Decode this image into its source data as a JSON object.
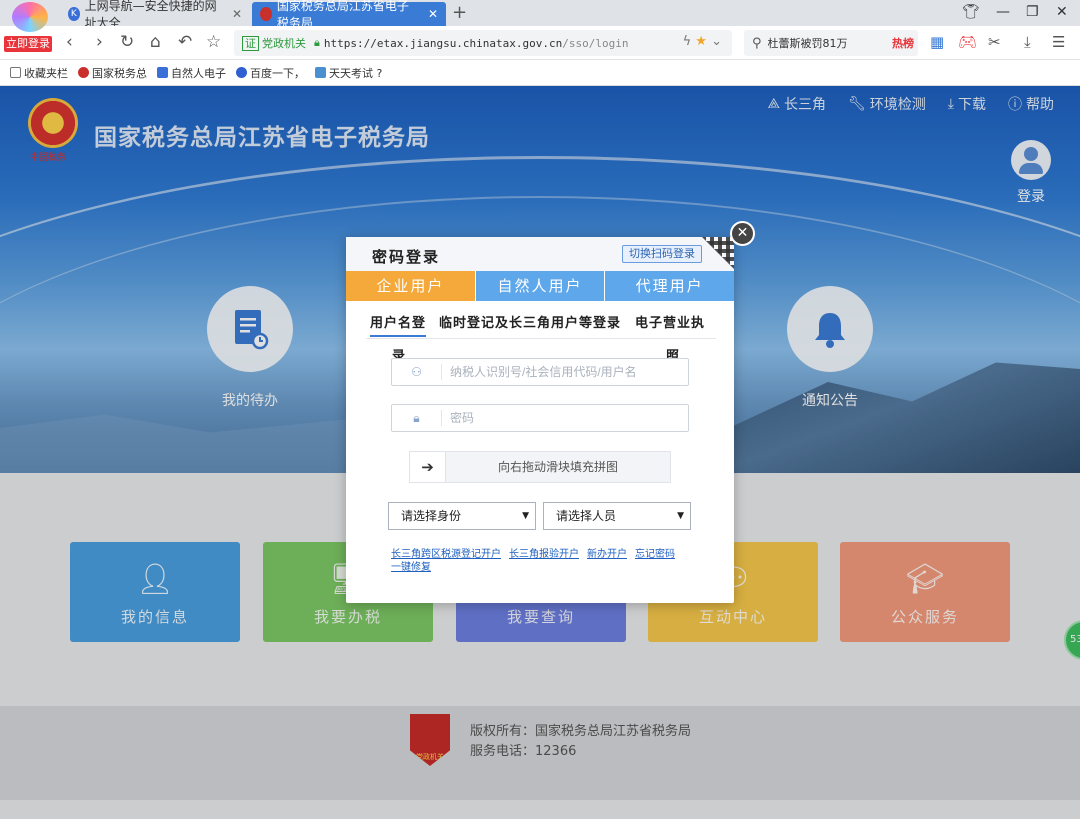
{
  "browser": {
    "login_btn": "立即登录",
    "tabs": [
      {
        "label": "上网导航—安全快捷的网址大全"
      },
      {
        "label": "国家税务总局江苏省电子税务局"
      }
    ],
    "gov_badge": "证",
    "gov_text": "党政机关",
    "url_host": "https://etax.jiangsu.chinatax.gov.cn",
    "url_path": "/sso/login",
    "search_text": "杜蕾斯被罚81万",
    "hot_label": "热榜",
    "bookmarks": [
      "收藏夹栏",
      "国家税务总",
      "自然人电子",
      "百度一下，",
      "天天考试 ?"
    ]
  },
  "header": {
    "seal_text": "中国税务",
    "site_title": "国家税务总局江苏省电子税务局",
    "links": [
      {
        "label": "长三角",
        "icon": "triangle-network-icon"
      },
      {
        "label": "环境检测",
        "icon": "wrench-icon"
      },
      {
        "label": "下载",
        "icon": "download-icon"
      },
      {
        "label": "帮助",
        "icon": "help-icon"
      }
    ],
    "login_label": "登录"
  },
  "quick": {
    "todo_label": "我的待办",
    "notice_label": "通知公告"
  },
  "tiles": [
    {
      "label": "我的信息",
      "color": "#4a9fe0"
    },
    {
      "label": "我要办税",
      "color": "#7dc765"
    },
    {
      "label": "我要查询",
      "color": "#6d7fe0"
    },
    {
      "label": "互动中心",
      "color": "#f4c64a"
    },
    {
      "label": "公众服务",
      "color": "#f29a7c"
    }
  ],
  "footer": {
    "badge_text": "党政机关",
    "copyright": "版权所有：国家税务总局江苏省税务局",
    "phone": "服务电话：12366",
    "float_badge": "53"
  },
  "modal": {
    "title": "密码登录",
    "switch_label": "切换扫码登录",
    "tabs": [
      {
        "label": "企业用户",
        "active": true
      },
      {
        "label": "自然人用户",
        "active": false
      },
      {
        "label": "代理用户",
        "active": false
      }
    ],
    "subtabs": {
      "username_login": "用户名登",
      "username_login_wrap": "录",
      "temp_login": "临时登记及长三角用户等登录",
      "license_login": "电子营业执",
      "license_login_wrap": "照"
    },
    "username_placeholder": "纳税人识别号/社会信用代码/用户名",
    "password_placeholder": "密码",
    "slider_label": "向右拖动滑块填充拼图",
    "identity_select": "请选择身份",
    "person_select": "请选择人员",
    "links": [
      "长三角跨区税源登记开户",
      "长三角报验开户",
      "新办开户",
      "忘记密码",
      "一键修复"
    ]
  }
}
